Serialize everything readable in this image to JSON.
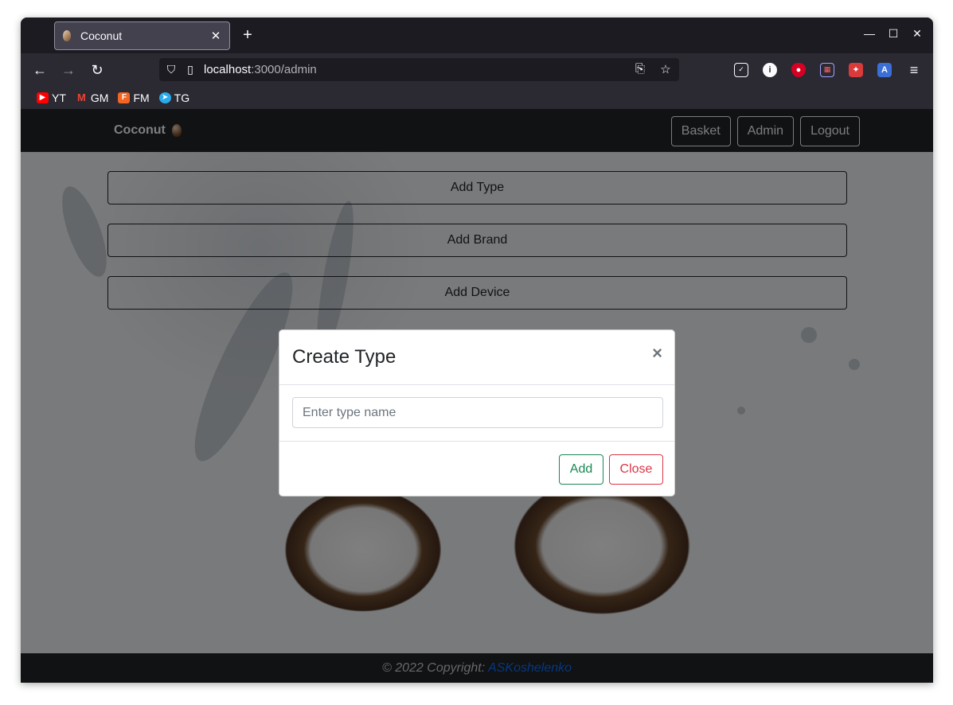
{
  "browser": {
    "tab_title": "Coconut",
    "url_host": "localhost",
    "url_path": ":3000/admin",
    "bookmarks": [
      {
        "label": "YT",
        "icon": "youtube-icon",
        "color": "#ff0000"
      },
      {
        "label": "GM",
        "icon": "gmail-icon",
        "color": "#ea4335"
      },
      {
        "label": "FM",
        "icon": "fm-icon",
        "color": "#f26522"
      },
      {
        "label": "TG",
        "icon": "telegram-icon",
        "color": "#2aabee"
      }
    ]
  },
  "app": {
    "brand": "Coconut",
    "nav": {
      "basket": "Basket",
      "admin": "Admin",
      "logout": "Logout"
    },
    "actions": {
      "add_type": "Add Type",
      "add_brand": "Add Brand",
      "add_device": "Add Device"
    },
    "footer": {
      "copyright": "© 2022 Copyright:",
      "author": "ASKoshelenko"
    }
  },
  "modal": {
    "title": "Create Type",
    "close_symbol": "×",
    "input_placeholder": "Enter type name",
    "input_value": "",
    "add_label": "Add",
    "close_label": "Close"
  },
  "colors": {
    "navbar": "#212529",
    "success": "#198754",
    "danger": "#dc3545",
    "link": "#0d6efd"
  }
}
